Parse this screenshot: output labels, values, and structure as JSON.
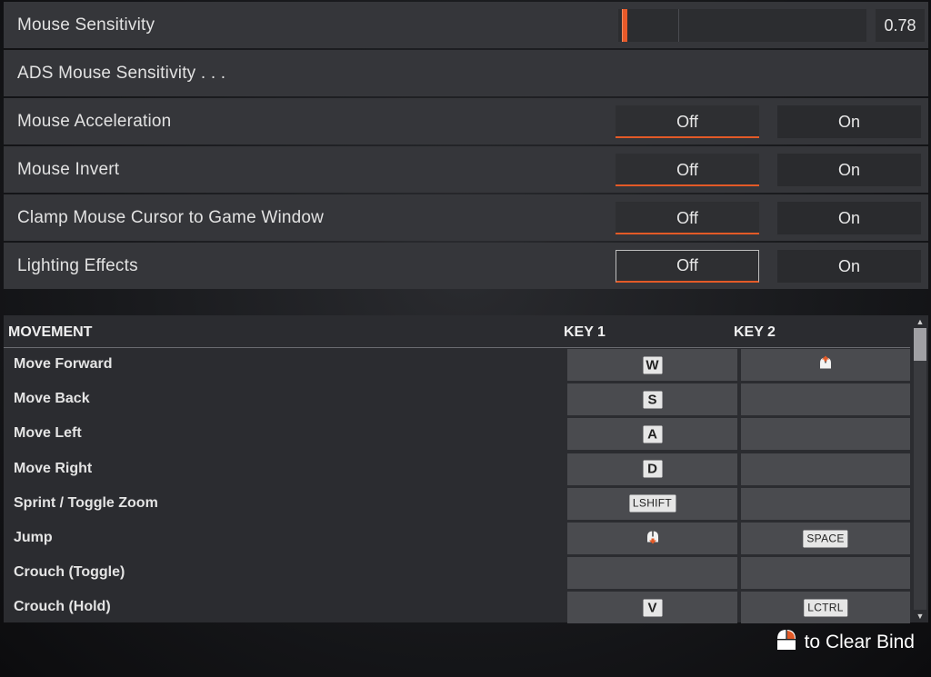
{
  "settings": {
    "mouse_sensitivity": {
      "label": "Mouse Sensitivity",
      "value": "0.78",
      "fraction": 0.026
    },
    "ads_sensitivity": {
      "label": "ADS Mouse Sensitivity . . ."
    },
    "toggles": [
      {
        "label": "Mouse Acceleration",
        "off": "Off",
        "on": "On",
        "selected": "Off"
      },
      {
        "label": "Mouse Invert",
        "off": "Off",
        "on": "On",
        "selected": "Off"
      },
      {
        "label": "Clamp Mouse Cursor to Game Window",
        "off": "Off",
        "on": "On",
        "selected": "Off"
      },
      {
        "label": "Lighting Effects",
        "off": "Off",
        "on": "On",
        "selected": "Off"
      }
    ]
  },
  "keybinds": {
    "section": "MOVEMENT",
    "key1_header": "KEY 1",
    "key2_header": "KEY 2",
    "rows": [
      {
        "action": "Move Forward",
        "key1": "W",
        "key2": "mouse-forward-icon"
      },
      {
        "action": "Move Back",
        "key1": "S",
        "key2": ""
      },
      {
        "action": "Move Left",
        "key1": "A",
        "key2": ""
      },
      {
        "action": "Move Right",
        "key1": "D",
        "key2": ""
      },
      {
        "action": "Sprint / Toggle Zoom",
        "key1": "LSHIFT",
        "key2": ""
      },
      {
        "action": "Jump",
        "key1": "mouse-wheel-down-icon",
        "key2": "SPACE"
      },
      {
        "action": "Crouch (Toggle)",
        "key1": "",
        "key2": ""
      },
      {
        "action": "Crouch (Hold)",
        "key1": "V",
        "key2": "LCTRL"
      }
    ]
  },
  "hint": {
    "text": "to Clear Bind",
    "icon": "mouse-right-click-icon"
  },
  "colors": {
    "accent": "#e35a27",
    "row_bg": "#35363a",
    "cell_bg": "#4a4b4f"
  }
}
